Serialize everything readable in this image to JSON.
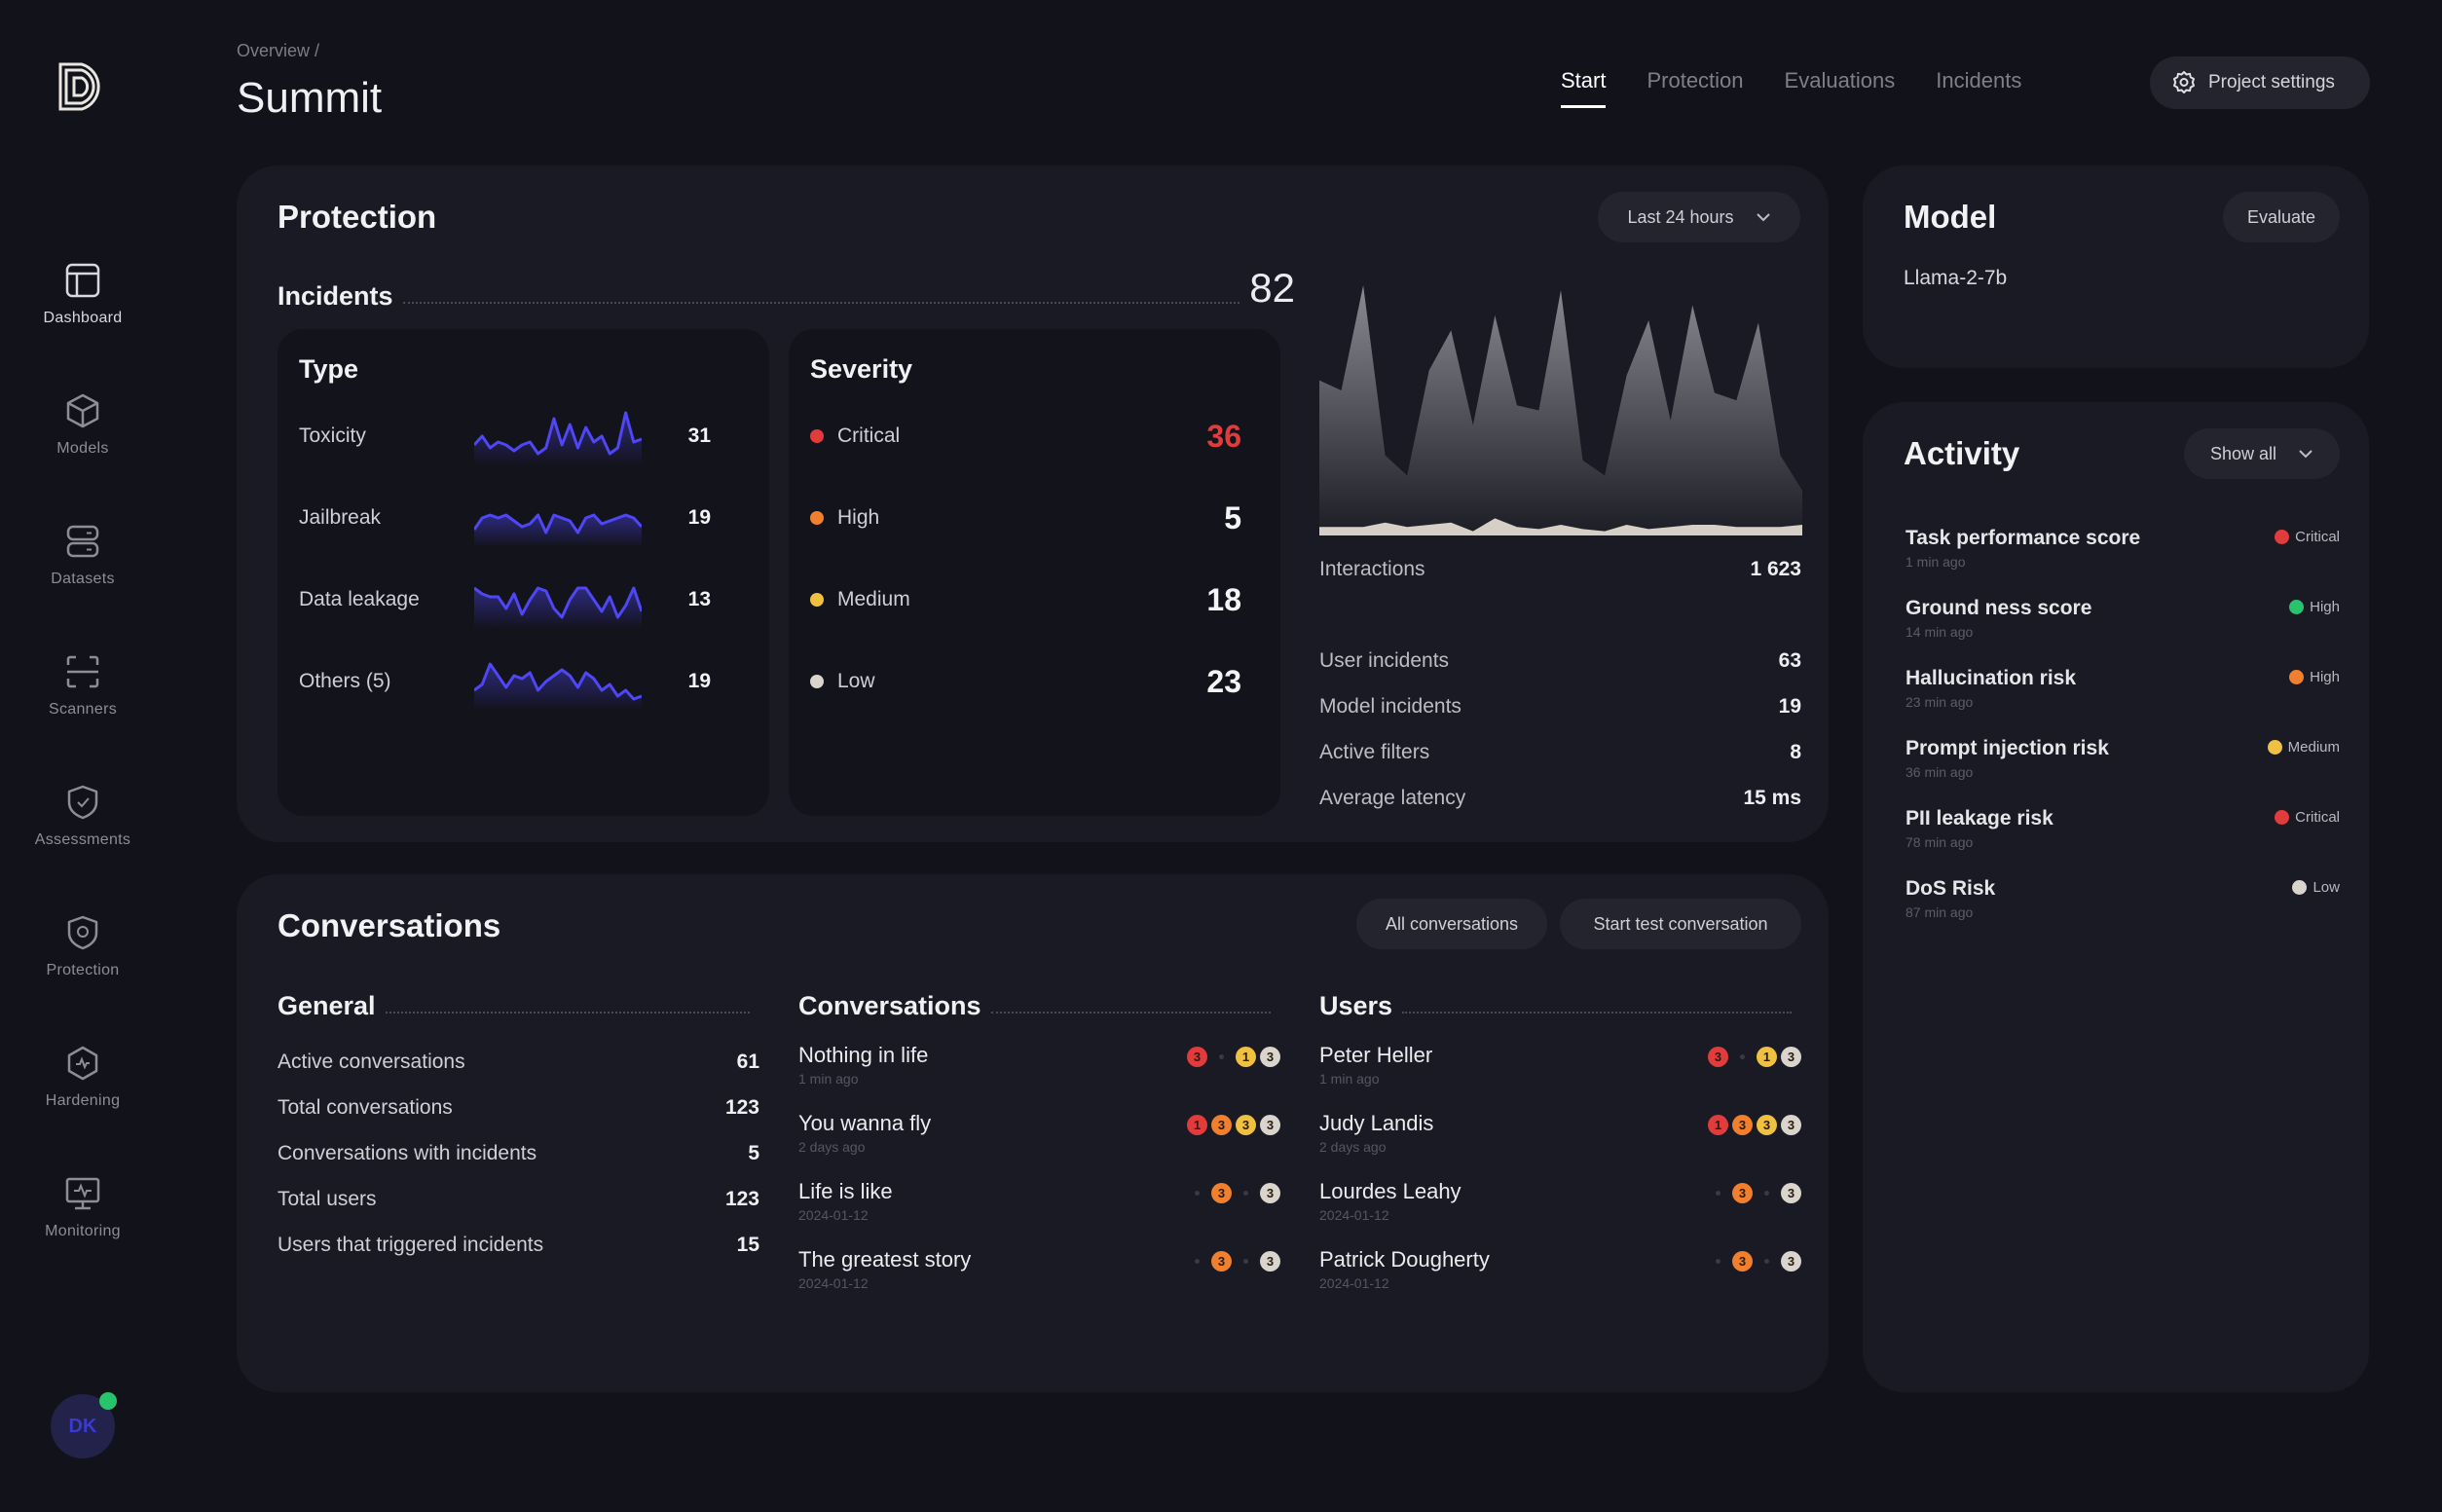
{
  "sidebar": {
    "logo": "D",
    "items": [
      {
        "label": "Dashboard",
        "icon": "dashboard-icon",
        "active": true
      },
      {
        "label": "Models",
        "icon": "cube-icon"
      },
      {
        "label": "Datasets",
        "icon": "database-icon"
      },
      {
        "label": "Scanners",
        "icon": "scanner-icon"
      },
      {
        "label": "Assessments",
        "icon": "shield-check-icon"
      },
      {
        "label": "Protection",
        "icon": "shield-icon"
      },
      {
        "label": "Hardening",
        "icon": "hexagon-pulse-icon"
      },
      {
        "label": "Monitoring",
        "icon": "monitor-pulse-icon"
      }
    ],
    "avatar": {
      "initials": "DK",
      "status_color": "#27c46b"
    }
  },
  "header": {
    "breadcrumb": "Overview /",
    "title": "Summit",
    "tabs": [
      {
        "label": "Start",
        "active": true
      },
      {
        "label": "Protection"
      },
      {
        "label": "Evaluations"
      },
      {
        "label": "Incidents"
      }
    ],
    "settings_label": "Project settings"
  },
  "colors": {
    "critical": "#e23b3b",
    "high": "#f07f2e",
    "medium": "#f0c040",
    "low": "#d9d4cc",
    "good": "#27c46b",
    "accent": "#4f46f5"
  },
  "protection": {
    "title": "Protection",
    "range_label": "Last 24 hours",
    "incidents_label": "Incidents",
    "incidents_total": "82",
    "type": {
      "title": "Type",
      "rows": [
        {
          "name": "Toxicity",
          "value": "31",
          "spark": [
            5,
            8,
            4,
            6,
            5,
            3,
            5,
            6,
            2,
            4,
            14,
            5,
            12,
            4,
            11,
            6,
            8,
            2,
            4,
            16,
            6,
            7
          ]
        },
        {
          "name": "Jailbreak",
          "value": "19",
          "spark": [
            4,
            8,
            9,
            8,
            9,
            7,
            5,
            6,
            9,
            3,
            9,
            8,
            7,
            3,
            8,
            9,
            6,
            7,
            8,
            9,
            8,
            5
          ]
        },
        {
          "name": "Data leakage",
          "value": "13",
          "spark": [
            12,
            10,
            9,
            9,
            5,
            10,
            3,
            8,
            12,
            11,
            5,
            2,
            8,
            12,
            12,
            8,
            4,
            9,
            2,
            6,
            12,
            4
          ]
        },
        {
          "name": "Others (5)",
          "value": "19",
          "spark": [
            5,
            7,
            14,
            10,
            6,
            10,
            9,
            11,
            5,
            8,
            10,
            12,
            10,
            6,
            11,
            9,
            5,
            7,
            3,
            5,
            2,
            3
          ]
        }
      ]
    },
    "severity": {
      "title": "Severity",
      "rows": [
        {
          "name": "Critical",
          "value": "36",
          "level": "critical"
        },
        {
          "name": "High",
          "value": "5",
          "level": "high"
        },
        {
          "name": "Medium",
          "value": "18",
          "level": "medium"
        },
        {
          "name": "Low",
          "value": "23",
          "level": "low"
        }
      ]
    },
    "interactions": {
      "label": "Interactions",
      "value": "1 623",
      "series_total": [
        62,
        58,
        100,
        32,
        24,
        66,
        82,
        44,
        88,
        52,
        50,
        98,
        30,
        24,
        64,
        86,
        46,
        92,
        57,
        54,
        85,
        32,
        18
      ],
      "series_incidents": [
        4,
        4,
        4,
        6,
        4,
        5,
        6,
        2,
        8,
        4,
        3,
        5,
        3,
        2,
        5,
        3,
        4,
        5,
        5,
        4,
        4,
        4,
        5
      ]
    },
    "stats": [
      {
        "label": "User incidents",
        "value": "63"
      },
      {
        "label": "Model incidents",
        "value": "19"
      },
      {
        "label": "Active filters",
        "value": "8"
      },
      {
        "label": "Average latency",
        "value": "15 ms"
      }
    ]
  },
  "model": {
    "title": "Model",
    "evaluate_label": "Evaluate",
    "name": "Llama-2-7b"
  },
  "activity": {
    "title": "Activity",
    "filter_label": "Show all",
    "items": [
      {
        "title": "Task performance score",
        "time": "1 min ago",
        "severity": "Critical",
        "level": "critical"
      },
      {
        "title": "Ground ness score",
        "time": "14 min ago",
        "severity": "High",
        "level": "good"
      },
      {
        "title": "Hallucination risk",
        "time": "23 min ago",
        "severity": "High",
        "level": "high"
      },
      {
        "title": "Prompt injection risk",
        "time": "36 min ago",
        "severity": "Medium",
        "level": "medium"
      },
      {
        "title": "PII leakage risk",
        "time": "78 min ago",
        "severity": "Critical",
        "level": "critical"
      },
      {
        "title": "DoS Risk",
        "time": "87 min ago",
        "severity": "Low",
        "level": "low"
      }
    ]
  },
  "conversations": {
    "title": "Conversations",
    "all_label": "All conversations",
    "start_label": "Start test conversation",
    "general": {
      "title": "General",
      "rows": [
        {
          "label": "Active conversations",
          "value": "61"
        },
        {
          "label": "Total conversations",
          "value": "123"
        },
        {
          "label": "Conversations with incidents",
          "value": "5"
        },
        {
          "label": "Total users",
          "value": "123"
        },
        {
          "label": "Users that triggered incidents",
          "value": "15"
        }
      ]
    },
    "list": {
      "title": "Conversations",
      "rows": [
        {
          "title": "Nothing in life",
          "time": "1 min ago",
          "badges": [
            "3",
            "",
            "1",
            "3"
          ]
        },
        {
          "title": "You wanna fly",
          "time": "2 days ago",
          "badges": [
            "1",
            "3",
            "3",
            "3"
          ]
        },
        {
          "title": "Life is like",
          "time": "2024-01-12",
          "badges": [
            "",
            "3",
            "",
            "3"
          ]
        },
        {
          "title": "The greatest story",
          "time": "2024-01-12",
          "badges": [
            "",
            "3",
            "",
            "3"
          ]
        }
      ]
    },
    "users": {
      "title": "Users",
      "rows": [
        {
          "title": "Peter Heller",
          "time": "1 min ago",
          "badges": [
            "3",
            "",
            "1",
            "3"
          ]
        },
        {
          "title": "Judy Landis",
          "time": "2 days ago",
          "badges": [
            "1",
            "3",
            "3",
            "3"
          ]
        },
        {
          "title": "Lourdes Leahy",
          "time": "2024-01-12",
          "badges": [
            "",
            "3",
            "",
            "3"
          ]
        },
        {
          "title": "Patrick Dougherty",
          "time": "2024-01-12",
          "badges": [
            "",
            "3",
            "",
            "3"
          ]
        }
      ]
    }
  }
}
